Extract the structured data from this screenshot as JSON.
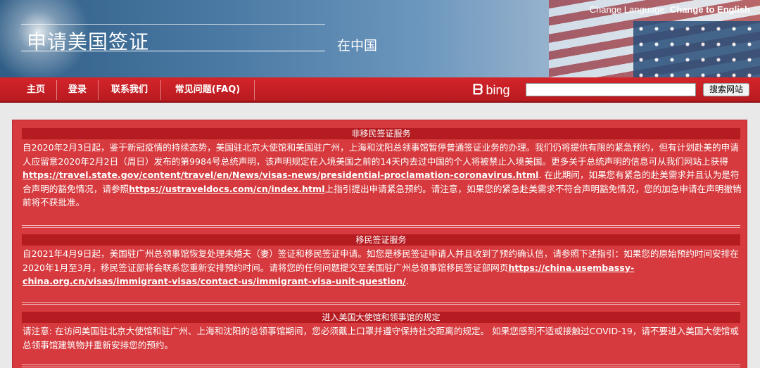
{
  "header": {
    "title": "申请美国签证",
    "subtitle": "在中国",
    "change_language_label": "Change Language:",
    "change_language_link": "Change to English"
  },
  "nav": {
    "items": [
      {
        "label": "主页"
      },
      {
        "label": "登录"
      },
      {
        "label": "联系我们"
      },
      {
        "label": "常见问题(FAQ)"
      }
    ],
    "search_brand": "bing",
    "search_button": "搜索网站",
    "search_value": ""
  },
  "sections": [
    {
      "heading": "非移民签证服务",
      "text_1": "自2020年2月3日起，鉴于新冠疫情的持续态势，美国驻北京大使馆和美国驻广州，上海和沈阳总领事馆暂停普通签证业务的办理。我们仍将提供有限的紧急预约，但有计划赴美的申请人应留意2020年2月2日（周日）发布的第9984号总统声明，该声明规定在入境美国之前的14天内去过中国的个人将被禁止入境美国。更多关于总统声明的信息可从我们网站上获得",
      "link_1": "https://travel.state.gov/content/travel/en/News/visas-news/presidential-proclamation-coronavirus.html",
      "text_2": ". 在此期间，如果您有紧急的赴美需求并且认为是符合声明的豁免情况，请参照",
      "link_2": "https://ustraveldocs.com/cn/index.html",
      "text_3": "上指引提出申请紧急预约。请注意，如果您的紧急赴美需求不符合声明豁免情况，您的加急申请在声明撤销前将不获批准。"
    },
    {
      "heading": "移民签证服务",
      "text_1": "自2021年4月9日起，美国驻广州总领事馆恢复处理未婚夫（妻）签证和移民签证申请。如您是移民签证申请人并且收到了预约确认信，请参照下述指引：如果您的原始预约时间安排在2020年1月至3月，移民签证部将会联系您重新安排预约时间。请将您的任何问题提交至美国驻广州总领事馆移民签证部网页",
      "link_1": "https://china.usembassy-china.org.cn/visas/immigrant-visas/contact-us/immigrant-visa-unit-question/",
      "text_2": "."
    },
    {
      "heading": "进入美国大使馆和领事馆的规定",
      "text_1": "请注意: 在访问美国驻北京大使馆和驻广州、上海和沈阳的总领事馆期间，您必须戴上口罩并遵守保持社交距离的规定。 如果您感到不适或接触过COVID-19，请不要进入美国大使馆或总领事馆建筑物并重新安排您的预约。"
    }
  ]
}
